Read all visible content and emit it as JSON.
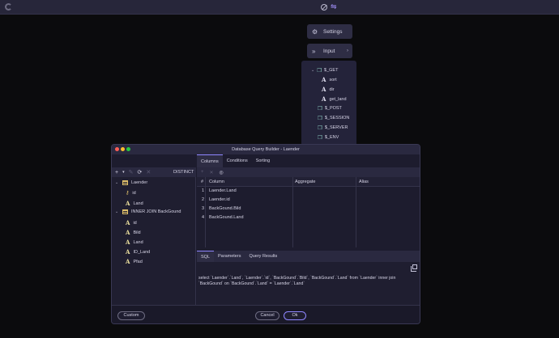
{
  "topbar": {
    "logo_icon": "app-logo-icon",
    "icons": [
      "disable-icon",
      "toggle-icon"
    ]
  },
  "menu": {
    "settings_label": "Settings",
    "input_label": "Input"
  },
  "input_tree": [
    {
      "label": "$_GET",
      "kind": "group",
      "expanded": true
    },
    {
      "label": "sort",
      "kind": "var"
    },
    {
      "label": "dir",
      "kind": "var"
    },
    {
      "label": "get_land",
      "kind": "var"
    },
    {
      "label": "$_POST",
      "kind": "group"
    },
    {
      "label": "$_SESSION",
      "kind": "group"
    },
    {
      "label": "$_SERVER",
      "kind": "group"
    },
    {
      "label": "$_ENV",
      "kind": "group"
    }
  ],
  "dialog": {
    "title": "Database Query Builder - Laender",
    "tabs": [
      "Columns",
      "Conditions",
      "Sorting"
    ],
    "active_tab": "Columns",
    "distinct_label": "DISTINCT",
    "tables": [
      {
        "name": "Laender",
        "fields": [
          {
            "name": "id",
            "type": "key"
          },
          {
            "name": "Land",
            "type": "text"
          }
        ]
      },
      {
        "name": "INNER JOIN BackGound",
        "fields": [
          {
            "name": "id",
            "type": "text"
          },
          {
            "name": "Bild",
            "type": "text"
          },
          {
            "name": "Land",
            "type": "text"
          },
          {
            "name": "ID_Land",
            "type": "text"
          },
          {
            "name": "Pfad",
            "type": "text"
          }
        ]
      }
    ],
    "grid": {
      "headers": [
        "#",
        "Column",
        "Aggregate",
        "Alias"
      ],
      "rows": [
        {
          "n": "1",
          "column": "Laender.Land"
        },
        {
          "n": "2",
          "column": "Laender.id"
        },
        {
          "n": "3",
          "column": "BackGound.Bild"
        },
        {
          "n": "4",
          "column": "BackGound.Land"
        }
      ]
    },
    "bottom_tabs": [
      "SQL",
      "Parameters",
      "Query Results"
    ],
    "active_bottom_tab": "SQL",
    "sql": "select `Laender`.`Land`, `Laender`.`id`, `BackGound`.`Bild`, `BackGound`.`Land` from `Laender` inner join `BackGound` on `BackGound`.`Land` = `Laender`.`Land`",
    "buttons": {
      "custom": "Custom",
      "cancel": "Cancel",
      "ok": "Ok"
    }
  },
  "colors": {
    "accent": "#8f86ff",
    "panel": "#1d1c2e",
    "table_icon": "#e0c06a"
  }
}
